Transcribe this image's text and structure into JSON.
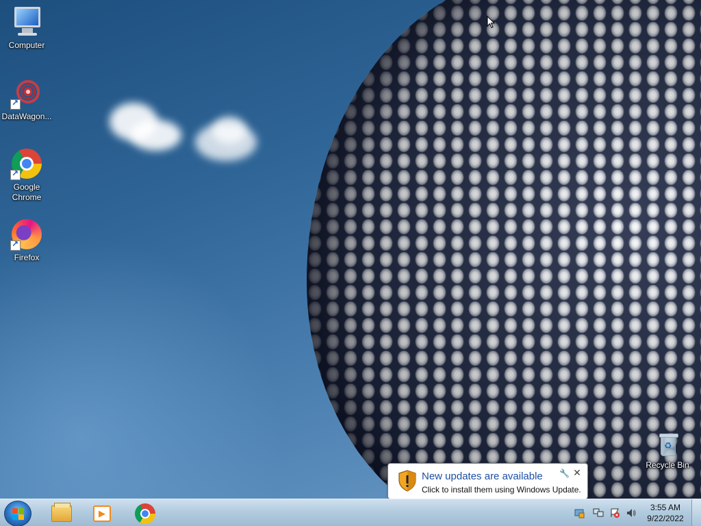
{
  "desktop": {
    "icons": [
      {
        "label": "Computer",
        "icon": "computer-icon"
      },
      {
        "label": "DataWagon...",
        "icon": "datawagon-icon"
      },
      {
        "label": "Google Chrome",
        "icon": "chrome-icon"
      },
      {
        "label": "Firefox",
        "icon": "firefox-icon"
      },
      {
        "label": "Recycle Bin",
        "icon": "recycle-bin-icon"
      }
    ]
  },
  "notification": {
    "title": "New updates are available",
    "message": "Click to install them using Windows Update.",
    "icon": "shield-warning-icon",
    "pin_icon": "wrench-icon",
    "close_label": "✕"
  },
  "taskbar": {
    "start_icon": "windows-start-icon",
    "pinned": [
      {
        "name": "Windows Explorer",
        "icon": "folder-icon"
      },
      {
        "name": "Windows Media Player",
        "icon": "media-player-icon"
      },
      {
        "name": "Google Chrome",
        "icon": "chrome-icon"
      }
    ],
    "tray": {
      "icons": [
        "windows-update-icon",
        "network-icon",
        "action-center-icon",
        "volume-icon"
      ],
      "time": "3:55 AM",
      "date": "9/22/2022"
    }
  },
  "colors": {
    "notification_title": "#1e4fa3",
    "taskbar_top": "#cfe0ef",
    "taskbar_bottom": "#9fbbd3"
  }
}
